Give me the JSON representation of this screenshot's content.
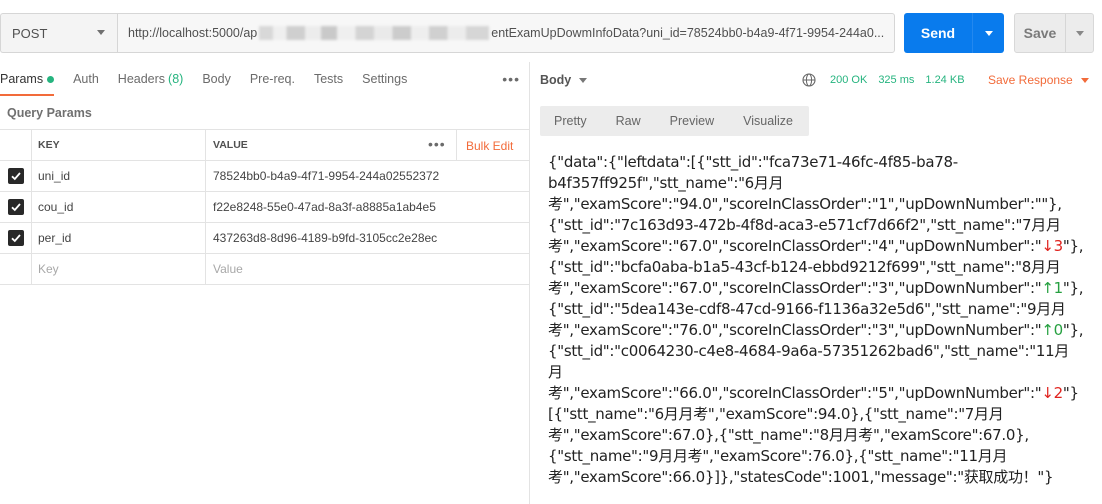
{
  "request": {
    "method": "POST",
    "url_start": "http://localhost:5000/ap",
    "url_end": "entExamUpDowmInfoData?uni_id=78524bb0-b4a9-4f71-9954-244a0...",
    "send_label": "Send",
    "save_label": "Save"
  },
  "left_tabs": {
    "params": "Params",
    "auth": "Auth",
    "headers": "Headers",
    "headers_count": "(8)",
    "body": "Body",
    "prereq": "Pre-req.",
    "tests": "Tests",
    "settings": "Settings"
  },
  "query_params": {
    "title": "Query Params",
    "col_key": "KEY",
    "col_value": "VALUE",
    "bulk_edit": "Bulk Edit",
    "rows": [
      {
        "key": "uni_id",
        "value": "78524bb0-b4a9-4f71-9954-244a02552372",
        "checked": true
      },
      {
        "key": "cou_id",
        "value": "f22e8248-55e0-47ad-8a3f-a8885a1ab4e5",
        "checked": true
      },
      {
        "key": "per_id",
        "value": "437263d8-8d96-4189-b9fd-3105cc2e28ec",
        "checked": true
      }
    ],
    "key_placeholder": "Key",
    "value_placeholder": "Value"
  },
  "response": {
    "body_label": "Body",
    "status": "200 OK",
    "time": "325 ms",
    "size": "1.24 KB",
    "save_response": "Save Response",
    "formats": [
      "Pretty",
      "Raw",
      "Preview",
      "Visualize"
    ],
    "lines": [
      "{\"data\":{\"leftdata\":[{\"stt_id\":\"fca73e71-46fc-4f85-ba78-",
      "b4f357ff925f\",\"stt_name\":\"6月月",
      "考\",\"examScore\":\"94.0\",\"scoreInClassOrder\":\"1\",\"upDownNumber\":\"\"},",
      "{\"stt_id\":\"7c163d93-472b-4f8d-aca3-e571cf7d66f2\",\"stt_name\":\"7月月",
      "考\",\"examScore\":\"67.0\",\"scoreInClassOrder\":\"4\",\"upDownNumber\":\"",
      "{\"stt_id\":\"bcfa0aba-b1a5-43cf-b124-ebbd9212f699\",\"stt_name\":\"8月月",
      "考\",\"examScore\":\"67.0\",\"scoreInClassOrder\":\"3\",\"upDownNumber\":\"",
      "{\"stt_id\":\"5dea143e-cdf8-47cd-9166-f1136a32e5d6\",\"stt_name\":\"9月月",
      "考\",\"examScore\":\"76.0\",\"scoreInClassOrder\":\"3\",\"upDownNumber\":\"",
      "{\"stt_id\":\"c0064230-c4e8-4684-9a6a-57351262bad6\",\"stt_name\":\"11月",
      "月",
      "考\",\"examScore\":\"66.0\",\"scoreInClassOrder\":\"5\",\"upDownNumber\":\"",
      "[{\"stt_name\":\"6月月考\",\"examScore\":94.0},{\"stt_name\":\"7月月",
      "考\",\"examScore\":67.0},{\"stt_name\":\"8月月考\",\"examScore\":67.0},",
      "{\"stt_name\":\"9月月考\",\"examScore\":76.0},{\"stt_name\":\"11月月",
      "考\",\"examScore\":66.0}]},\"statesCode\":1001,\"message\":\"获取成功！\"}"
    ],
    "arrows": {
      "line4": {
        "text": "↓3",
        "tail": "\"},"
      },
      "line6": {
        "text": "↑1",
        "tail": "\"},"
      },
      "line8": {
        "text": "↑0",
        "tail": "\"},"
      },
      "line11": {
        "text": "↓2",
        "tail": "\"}"
      }
    }
  },
  "colors": {
    "accent": "#f26b3a",
    "send_blue": "#097bed",
    "ok_green": "#26b47f"
  }
}
